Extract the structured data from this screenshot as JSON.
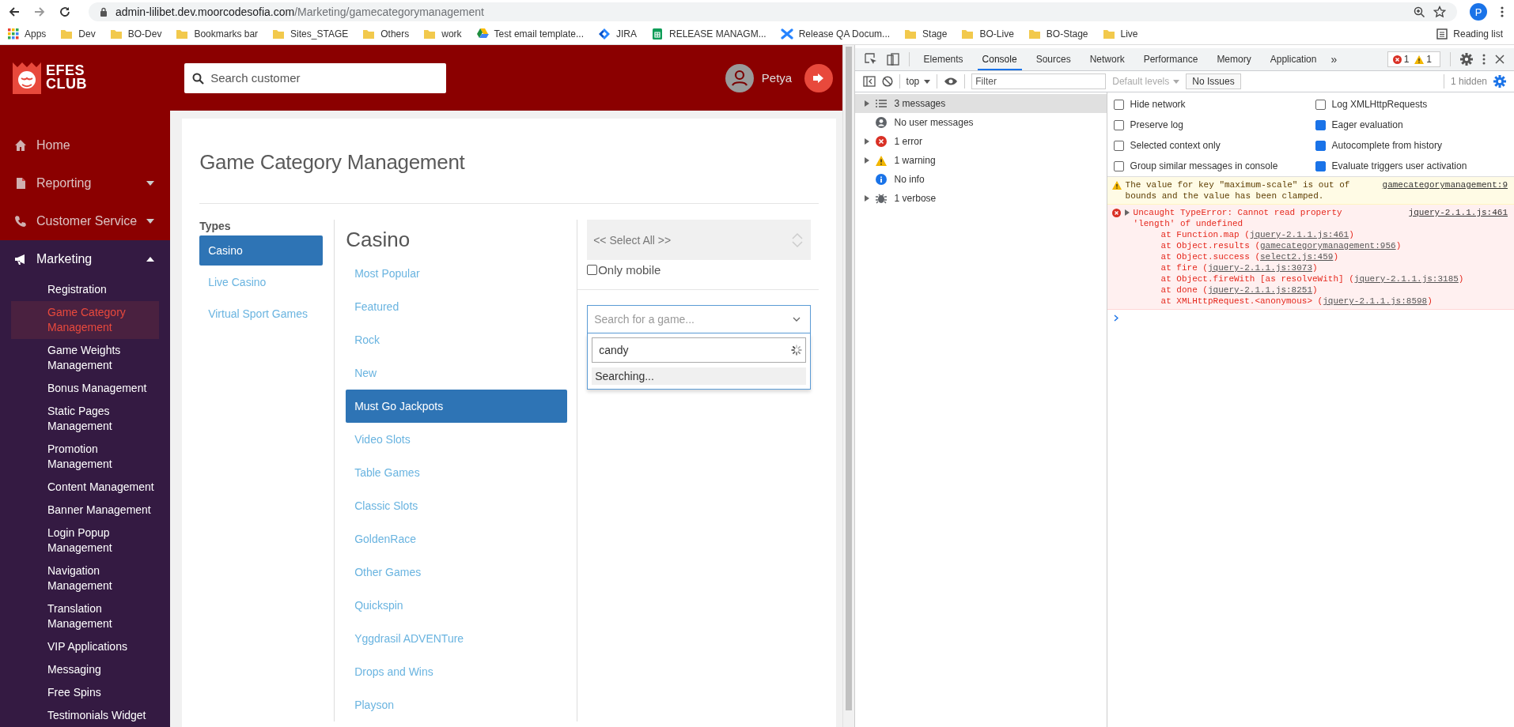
{
  "browser": {
    "url": {
      "host": "admin-lilibet.dev.moorcodesofia.com",
      "path": "/Marketing/gamecategorymanagement"
    },
    "profile": "P",
    "bookmarks": [
      {
        "label": "Apps",
        "kind": "apps"
      },
      {
        "label": "Dev",
        "kind": "folder"
      },
      {
        "label": "BO-Dev",
        "kind": "folder"
      },
      {
        "label": "Bookmarks bar",
        "kind": "folder"
      },
      {
        "label": "Sites_STAGE",
        "kind": "folder"
      },
      {
        "label": "Others",
        "kind": "folder"
      },
      {
        "label": "work",
        "kind": "folder"
      },
      {
        "label": "Test email template...",
        "kind": "link"
      },
      {
        "label": "JIRA",
        "kind": "link"
      },
      {
        "label": "RELEASE MANAGM...",
        "kind": "link"
      },
      {
        "label": "Release QA Docum...",
        "kind": "link"
      },
      {
        "label": "Stage",
        "kind": "folder"
      },
      {
        "label": "BO-Live",
        "kind": "folder"
      },
      {
        "label": "BO-Stage",
        "kind": "folder"
      },
      {
        "label": "Live",
        "kind": "folder"
      }
    ],
    "reading_list": "Reading list"
  },
  "app": {
    "logo": {
      "line_1": "EFES",
      "line_2": "CLUB"
    },
    "search": {
      "placeholder": "Search customer"
    },
    "user": "Petya",
    "nav": [
      {
        "label": "Home"
      },
      {
        "label": "Reporting",
        "expanded": false
      },
      {
        "label": "Customer Service",
        "expanded": false
      },
      {
        "label": "Marketing",
        "expanded": true,
        "children": [
          {
            "label": "Registration",
            "selected": false
          },
          {
            "label": "Game Category Management",
            "selected": true
          },
          {
            "label": "Game Weights Management",
            "selected": false
          },
          {
            "label": "Bonus Management",
            "selected": false
          },
          {
            "label": "Static Pages Management",
            "selected": false
          },
          {
            "label": "Promotion Management",
            "selected": false
          },
          {
            "label": "Content Management",
            "selected": false
          },
          {
            "label": "Banner Management",
            "selected": false
          },
          {
            "label": "Login Popup Management",
            "selected": false
          },
          {
            "label": "Navigation Management",
            "selected": false
          },
          {
            "label": "Translation Management",
            "selected": false
          },
          {
            "label": "VIP Applications",
            "selected": false
          },
          {
            "label": "Messaging",
            "selected": false
          },
          {
            "label": "Free Spins",
            "selected": false
          },
          {
            "label": "Testimonials Widget",
            "selected": false
          }
        ]
      }
    ],
    "page": {
      "title": "Game Category Management",
      "types": {
        "heading": "Types",
        "items": [
          {
            "label": "Casino",
            "selected": true
          },
          {
            "label": "Live Casino",
            "selected": false
          },
          {
            "label": "Virtual Sport Games",
            "selected": false
          }
        ]
      },
      "categories": {
        "heading": "Casino",
        "items": [
          {
            "label": "Most Popular",
            "selected": false
          },
          {
            "label": "Featured",
            "selected": false
          },
          {
            "label": "Rock",
            "selected": false
          },
          {
            "label": "New",
            "selected": false
          },
          {
            "label": "Must Go Jackpots",
            "selected": true
          },
          {
            "label": "Video Slots",
            "selected": false
          },
          {
            "label": "Table Games",
            "selected": false
          },
          {
            "label": "Classic Slots",
            "selected": false
          },
          {
            "label": "GoldenRace",
            "selected": false
          },
          {
            "label": "Other Games",
            "selected": false
          },
          {
            "label": "Quickspin",
            "selected": false
          },
          {
            "label": "Yggdrasil ADVENTure",
            "selected": false
          },
          {
            "label": "Drops and Wins",
            "selected": false
          },
          {
            "label": "Playson",
            "selected": false
          }
        ]
      },
      "games": {
        "select_all": "<< Select All >>",
        "only_mobile": {
          "label": "Only mobile",
          "checked": false
        },
        "game_search": {
          "placeholder": "Search for a game...",
          "query": "candy",
          "status": "Searching..."
        }
      }
    }
  },
  "devtools": {
    "tabs": [
      {
        "label": "Elements",
        "selected": false
      },
      {
        "label": "Console",
        "selected": true
      },
      {
        "label": "Sources",
        "selected": false
      },
      {
        "label": "Network",
        "selected": false
      },
      {
        "label": "Performance",
        "selected": false
      },
      {
        "label": "Memory",
        "selected": false
      },
      {
        "label": "Application",
        "selected": false
      }
    ],
    "more": "»",
    "error_count": "1",
    "warning_count": "1",
    "toolbar": {
      "context": "top",
      "filter_placeholder": "Filter",
      "levels": "Default levels",
      "issues": "No Issues",
      "hidden": "1 hidden"
    },
    "sidebar": [
      {
        "label": "3 messages",
        "kind": "all",
        "selected": true
      },
      {
        "label": "No user messages",
        "kind": "user",
        "selected": false
      },
      {
        "label": "1 error",
        "kind": "error",
        "selected": false
      },
      {
        "label": "1 warning",
        "kind": "warning",
        "selected": false
      },
      {
        "label": "No info",
        "kind": "info",
        "selected": false
      },
      {
        "label": "1 verbose",
        "kind": "verbose",
        "selected": false
      }
    ],
    "settings": [
      {
        "label": "Hide network",
        "checked": false
      },
      {
        "label": "Preserve log",
        "checked": false
      },
      {
        "label": "Selected context only",
        "checked": false
      },
      {
        "label": "Group similar messages in console",
        "checked": false
      },
      {
        "label": "Log XMLHttpRequests",
        "checked": false
      },
      {
        "label": "Eager evaluation",
        "checked": true
      },
      {
        "label": "Autocomplete from history",
        "checked": true
      },
      {
        "label": "Evaluate triggers user activation",
        "checked": true
      }
    ],
    "messages": [
      {
        "kind": "warning",
        "text": "The value for key \"maximum-scale\" is out of bounds and the value has been clamped.",
        "source": "gamecategorymanagement:9"
      },
      {
        "kind": "error",
        "text": "Uncaught TypeError: Cannot read property 'length' of undefined",
        "source": "jquery-2.1.1.js:461",
        "stack": [
          {
            "call": "at Function.map (",
            "link": "jquery-2.1.1.js:461",
            "end": ")"
          },
          {
            "call": "at Object.results (",
            "link": "gamecategorymanagement:956",
            "end": ")"
          },
          {
            "call": "at Object.success (",
            "link": "select2.js:459",
            "end": ")"
          },
          {
            "call": "at fire (",
            "link": "jquery-2.1.1.js:3073",
            "end": ")"
          },
          {
            "call": "at Object.fireWith [as resolveWith] (",
            "link": "jquery-2.1.1.js:3185",
            "end": ")"
          },
          {
            "call": "at done (",
            "link": "jquery-2.1.1.js:8251",
            "end": ")"
          },
          {
            "call": "at XMLHttpRequest.<anonymous> (",
            "link": "jquery-2.1.1.js:8598",
            "end": ")"
          }
        ]
      }
    ]
  }
}
